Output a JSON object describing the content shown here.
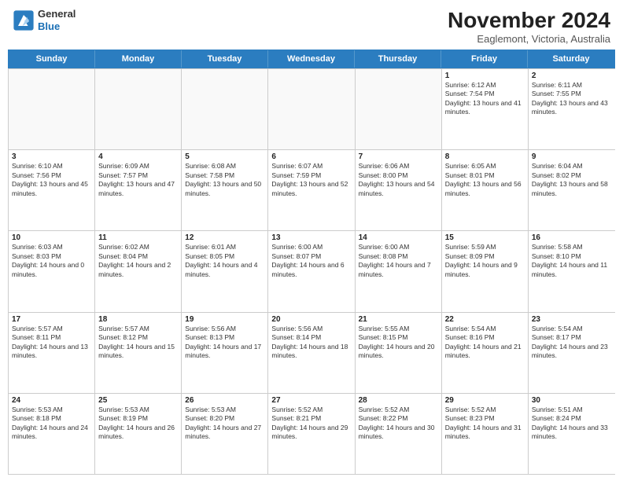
{
  "header": {
    "logo_line1": "General",
    "logo_line2": "Blue",
    "month": "November 2024",
    "location": "Eaglemont, Victoria, Australia"
  },
  "days_of_week": [
    "Sunday",
    "Monday",
    "Tuesday",
    "Wednesday",
    "Thursday",
    "Friday",
    "Saturday"
  ],
  "weeks": [
    [
      {
        "day": "",
        "empty": true
      },
      {
        "day": "",
        "empty": true
      },
      {
        "day": "",
        "empty": true
      },
      {
        "day": "",
        "empty": true
      },
      {
        "day": "",
        "empty": true
      },
      {
        "day": "1",
        "sunrise": "6:12 AM",
        "sunset": "7:54 PM",
        "daylight": "13 hours and 41 minutes."
      },
      {
        "day": "2",
        "sunrise": "6:11 AM",
        "sunset": "7:55 PM",
        "daylight": "13 hours and 43 minutes."
      }
    ],
    [
      {
        "day": "3",
        "sunrise": "6:10 AM",
        "sunset": "7:56 PM",
        "daylight": "13 hours and 45 minutes."
      },
      {
        "day": "4",
        "sunrise": "6:09 AM",
        "sunset": "7:57 PM",
        "daylight": "13 hours and 47 minutes."
      },
      {
        "day": "5",
        "sunrise": "6:08 AM",
        "sunset": "7:58 PM",
        "daylight": "13 hours and 50 minutes."
      },
      {
        "day": "6",
        "sunrise": "6:07 AM",
        "sunset": "7:59 PM",
        "daylight": "13 hours and 52 minutes."
      },
      {
        "day": "7",
        "sunrise": "6:06 AM",
        "sunset": "8:00 PM",
        "daylight": "13 hours and 54 minutes."
      },
      {
        "day": "8",
        "sunrise": "6:05 AM",
        "sunset": "8:01 PM",
        "daylight": "13 hours and 56 minutes."
      },
      {
        "day": "9",
        "sunrise": "6:04 AM",
        "sunset": "8:02 PM",
        "daylight": "13 hours and 58 minutes."
      }
    ],
    [
      {
        "day": "10",
        "sunrise": "6:03 AM",
        "sunset": "8:03 PM",
        "daylight": "14 hours and 0 minutes."
      },
      {
        "day": "11",
        "sunrise": "6:02 AM",
        "sunset": "8:04 PM",
        "daylight": "14 hours and 2 minutes."
      },
      {
        "day": "12",
        "sunrise": "6:01 AM",
        "sunset": "8:05 PM",
        "daylight": "14 hours and 4 minutes."
      },
      {
        "day": "13",
        "sunrise": "6:00 AM",
        "sunset": "8:07 PM",
        "daylight": "14 hours and 6 minutes."
      },
      {
        "day": "14",
        "sunrise": "6:00 AM",
        "sunset": "8:08 PM",
        "daylight": "14 hours and 7 minutes."
      },
      {
        "day": "15",
        "sunrise": "5:59 AM",
        "sunset": "8:09 PM",
        "daylight": "14 hours and 9 minutes."
      },
      {
        "day": "16",
        "sunrise": "5:58 AM",
        "sunset": "8:10 PM",
        "daylight": "14 hours and 11 minutes."
      }
    ],
    [
      {
        "day": "17",
        "sunrise": "5:57 AM",
        "sunset": "8:11 PM",
        "daylight": "14 hours and 13 minutes."
      },
      {
        "day": "18",
        "sunrise": "5:57 AM",
        "sunset": "8:12 PM",
        "daylight": "14 hours and 15 minutes."
      },
      {
        "day": "19",
        "sunrise": "5:56 AM",
        "sunset": "8:13 PM",
        "daylight": "14 hours and 17 minutes."
      },
      {
        "day": "20",
        "sunrise": "5:56 AM",
        "sunset": "8:14 PM",
        "daylight": "14 hours and 18 minutes."
      },
      {
        "day": "21",
        "sunrise": "5:55 AM",
        "sunset": "8:15 PM",
        "daylight": "14 hours and 20 minutes."
      },
      {
        "day": "22",
        "sunrise": "5:54 AM",
        "sunset": "8:16 PM",
        "daylight": "14 hours and 21 minutes."
      },
      {
        "day": "23",
        "sunrise": "5:54 AM",
        "sunset": "8:17 PM",
        "daylight": "14 hours and 23 minutes."
      }
    ],
    [
      {
        "day": "24",
        "sunrise": "5:53 AM",
        "sunset": "8:18 PM",
        "daylight": "14 hours and 24 minutes."
      },
      {
        "day": "25",
        "sunrise": "5:53 AM",
        "sunset": "8:19 PM",
        "daylight": "14 hours and 26 minutes."
      },
      {
        "day": "26",
        "sunrise": "5:53 AM",
        "sunset": "8:20 PM",
        "daylight": "14 hours and 27 minutes."
      },
      {
        "day": "27",
        "sunrise": "5:52 AM",
        "sunset": "8:21 PM",
        "daylight": "14 hours and 29 minutes."
      },
      {
        "day": "28",
        "sunrise": "5:52 AM",
        "sunset": "8:22 PM",
        "daylight": "14 hours and 30 minutes."
      },
      {
        "day": "29",
        "sunrise": "5:52 AM",
        "sunset": "8:23 PM",
        "daylight": "14 hours and 31 minutes."
      },
      {
        "day": "30",
        "sunrise": "5:51 AM",
        "sunset": "8:24 PM",
        "daylight": "14 hours and 33 minutes."
      }
    ]
  ]
}
